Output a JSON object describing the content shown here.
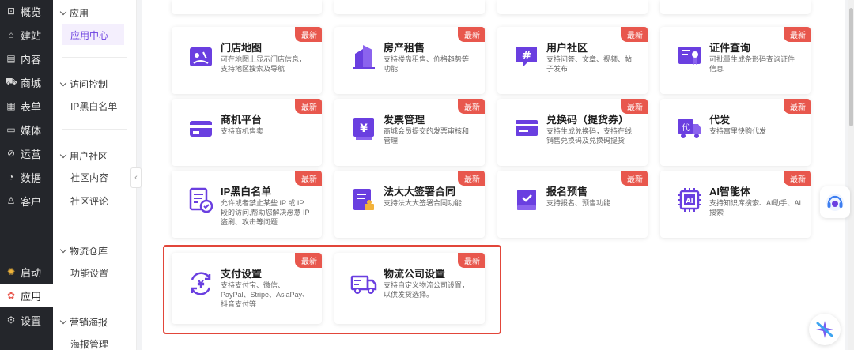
{
  "colors": {
    "accent": "#6a3fe0",
    "badge": "#e8574d",
    "nav_bg": "#24262b"
  },
  "nav": {
    "items": [
      {
        "label": "概览",
        "icon": "bag-icon",
        "glyph": "⊡"
      },
      {
        "label": "建站",
        "icon": "home-icon",
        "glyph": "⌂"
      },
      {
        "label": "内容",
        "icon": "document-icon",
        "glyph": "▤"
      },
      {
        "label": "商城",
        "icon": "cart-icon",
        "glyph": "⛟"
      },
      {
        "label": "表单",
        "icon": "form-icon",
        "glyph": "▦"
      },
      {
        "label": "媒体",
        "icon": "video-icon",
        "glyph": "▭"
      },
      {
        "label": "运营",
        "icon": "paperclip-icon",
        "glyph": "⊘"
      },
      {
        "label": "数据",
        "icon": "pie-chart-icon",
        "glyph": "◔"
      },
      {
        "label": "客户",
        "icon": "user-icon",
        "glyph": "♙"
      }
    ],
    "bottom": [
      {
        "label": "启动",
        "icon": "sparkle-icon",
        "glyph": "✺"
      },
      {
        "label": "应用",
        "icon": "apps-icon",
        "glyph": "✿"
      },
      {
        "label": "设置",
        "icon": "gear-icon",
        "glyph": "⚙"
      }
    ]
  },
  "submenu": {
    "groups": [
      {
        "title": "应用",
        "items": [
          "应用中心"
        ]
      },
      {
        "title": "访问控制",
        "items": [
          "IP黑白名单"
        ]
      },
      {
        "title": "用户社区",
        "items": [
          "社区内容",
          "社区评论"
        ]
      },
      {
        "title": "物流仓库",
        "items": [
          "功能设置"
        ]
      },
      {
        "title": "营销海报",
        "items": [
          "海报管理"
        ]
      }
    ]
  },
  "badge_label": "最新",
  "cards": [
    {
      "title": "门店地图",
      "desc": "可在地图上显示门店信息，支持地区搜索及导航",
      "icon": "map-icon"
    },
    {
      "title": "房产租售",
      "desc": "支持楼盘租售、价格趋势等功能",
      "icon": "building-icon"
    },
    {
      "title": "用户社区",
      "desc": "支持问答、文章、视频、帖子发布",
      "icon": "hashtag-icon"
    },
    {
      "title": "证件查询",
      "desc": "可批量生成条形码查询证件信息",
      "icon": "certificate-icon"
    },
    {
      "title": "商机平台",
      "desc": "支持商机售卖",
      "icon": "card-icon"
    },
    {
      "title": "发票管理",
      "desc": "商城会员提交的发票审核和管理",
      "icon": "invoice-icon"
    },
    {
      "title": "兑换码（提货券）",
      "desc": "支持生成兑换码，支持在线销售兑换码及兑换码提货",
      "icon": "voucher-icon"
    },
    {
      "title": "代发",
      "desc": "支持寓里快购代发",
      "icon": "delivery-truck-icon"
    },
    {
      "title": "IP黑白名单",
      "desc": "允许或者禁止某些 IP 或 IP 段的访问,帮助您解决恶意 IP 盗刷、攻击等问题",
      "icon": "checklist-icon"
    },
    {
      "title": "法大大签署合同",
      "desc": "支持法大大签署合同功能",
      "icon": "contract-icon"
    },
    {
      "title": "报名预售",
      "desc": "支持报名、预售功能",
      "icon": "book-check-icon"
    },
    {
      "title": "AI智能体",
      "desc": "支持知识库搜索、AI助手、AI搜索",
      "icon": "ai-chip-icon"
    },
    {
      "title": "支付设置",
      "desc": "支持支付宝、微信、PayPal、Stripe、AsiaPay、抖音支付等",
      "icon": "payment-yen-icon"
    },
    {
      "title": "物流公司设置",
      "desc": "支持自定义物流公司设置，以供发货选择。",
      "icon": "logistics-truck-icon"
    }
  ]
}
